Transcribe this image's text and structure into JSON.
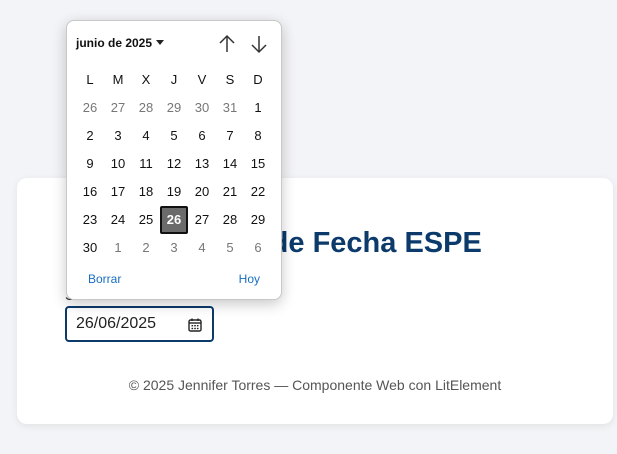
{
  "card": {
    "title": "Selector de Fecha ESPE",
    "field_label": "Seleccione una fecha:",
    "date_value": "26/06/2025",
    "footer": "© 2025 Jennifer Torres — Componente Web con LitElement"
  },
  "picker": {
    "month_label": "junio de 2025",
    "weekdays": [
      "L",
      "M",
      "X",
      "J",
      "V",
      "S",
      "D"
    ],
    "weeks": [
      [
        {
          "d": "26",
          "o": true
        },
        {
          "d": "27",
          "o": true
        },
        {
          "d": "28",
          "o": true
        },
        {
          "d": "29",
          "o": true
        },
        {
          "d": "30",
          "o": true
        },
        {
          "d": "31",
          "o": true
        },
        {
          "d": "1",
          "o": false
        }
      ],
      [
        {
          "d": "2",
          "o": false
        },
        {
          "d": "3",
          "o": false
        },
        {
          "d": "4",
          "o": false
        },
        {
          "d": "5",
          "o": false
        },
        {
          "d": "6",
          "o": false
        },
        {
          "d": "7",
          "o": false
        },
        {
          "d": "8",
          "o": false
        }
      ],
      [
        {
          "d": "9",
          "o": false
        },
        {
          "d": "10",
          "o": false
        },
        {
          "d": "11",
          "o": false
        },
        {
          "d": "12",
          "o": false
        },
        {
          "d": "13",
          "o": false
        },
        {
          "d": "14",
          "o": false
        },
        {
          "d": "15",
          "o": false
        }
      ],
      [
        {
          "d": "16",
          "o": false
        },
        {
          "d": "17",
          "o": false
        },
        {
          "d": "18",
          "o": false
        },
        {
          "d": "19",
          "o": false
        },
        {
          "d": "20",
          "o": false
        },
        {
          "d": "21",
          "o": false
        },
        {
          "d": "22",
          "o": false
        }
      ],
      [
        {
          "d": "23",
          "o": false
        },
        {
          "d": "24",
          "o": false
        },
        {
          "d": "25",
          "o": false
        },
        {
          "d": "26",
          "o": false,
          "s": true
        },
        {
          "d": "27",
          "o": false
        },
        {
          "d": "28",
          "o": false
        },
        {
          "d": "29",
          "o": false
        }
      ],
      [
        {
          "d": "30",
          "o": false
        },
        {
          "d": "1",
          "o": true
        },
        {
          "d": "2",
          "o": true
        },
        {
          "d": "3",
          "o": true
        },
        {
          "d": "4",
          "o": true
        },
        {
          "d": "5",
          "o": true
        },
        {
          "d": "6",
          "o": true
        }
      ]
    ],
    "clear_label": "Borrar",
    "today_label": "Hoy",
    "icons": {
      "prev": "arrow-up-icon",
      "next": "arrow-down-icon",
      "caret": "caret-down-icon"
    }
  },
  "colors": {
    "title": "#0b3a6b",
    "input_border": "#0b3a6b",
    "link": "#1a6fc2",
    "selected_day": "#6b6b6b"
  }
}
